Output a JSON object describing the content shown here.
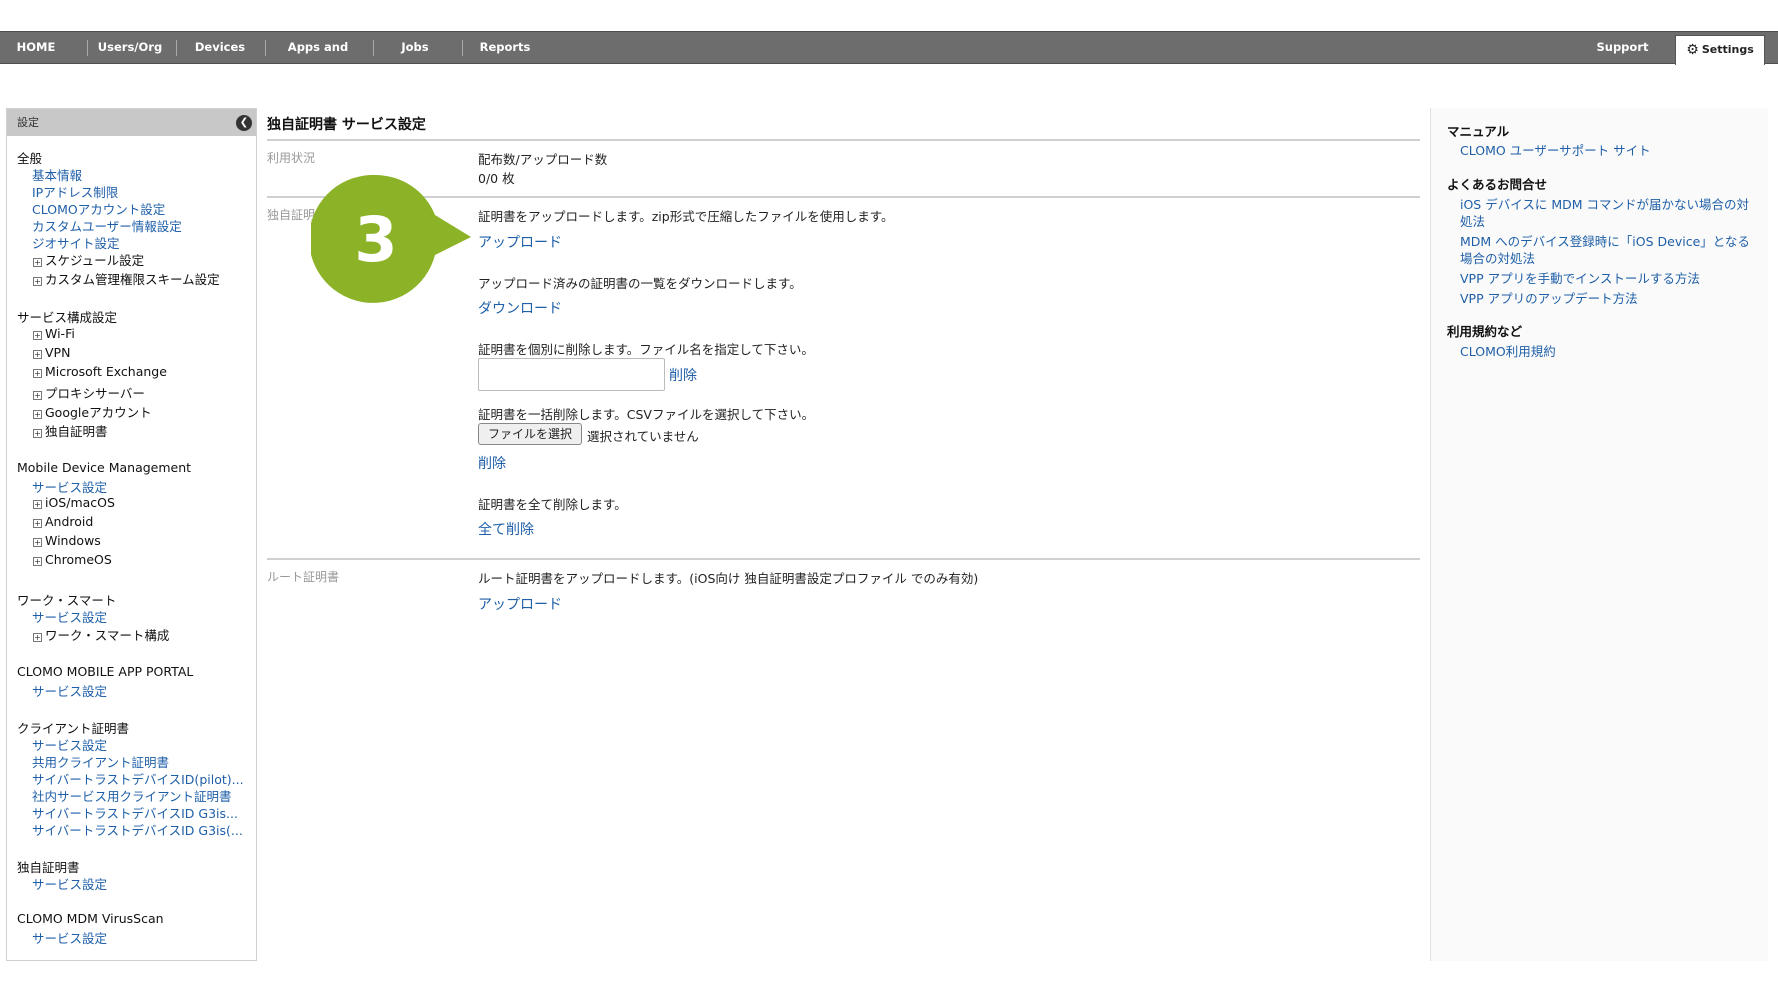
{
  "nav": {
    "items": [
      "HOME",
      "Users/Org",
      "Devices",
      "Apps and Books",
      "Jobs",
      "Reports"
    ],
    "support": "Support",
    "settings": "Settings"
  },
  "sidebar": {
    "header": "設定",
    "collapse_icon": "chevron-left-icon",
    "sections": {
      "general": {
        "title": "全般",
        "links": [
          "基本情報",
          "IPアドレス制限",
          "CLOMOアカウント設定",
          "カスタムユーザー情報設定",
          "ジオサイト設定"
        ],
        "expandables": [
          "スケジュール設定",
          "カスタム管理権限スキーム設定"
        ]
      },
      "service_config": {
        "title": "サービス構成設定",
        "expandables": [
          "Wi-Fi",
          "VPN",
          "Microsoft Exchange",
          "プロキシサーバー",
          "Googleアカウント",
          "独自証明書"
        ]
      },
      "mdm": {
        "title": "Mobile Device Management",
        "links": [
          "サービス設定"
        ],
        "expandables": [
          "iOS/macOS",
          "Android",
          "Windows",
          "ChromeOS"
        ]
      },
      "work_smart": {
        "title": "ワーク・スマート",
        "links": [
          "サービス設定"
        ],
        "expandables": [
          "ワーク・スマート構成"
        ]
      },
      "app_portal": {
        "title": "CLOMO MOBILE APP PORTAL",
        "links": [
          "サービス設定"
        ]
      },
      "client_cert": {
        "title": "クライアント証明書",
        "links": [
          "サービス設定",
          "共用クライアント証明書",
          "サイバートラストデバイスID(pilot)...",
          "社内サービス用クライアント証明書",
          "サイバートラストデバイスID G3is...",
          "サイバートラストデバイスID G3is(..."
        ]
      },
      "own_cert": {
        "title": "独自証明書",
        "links": [
          "サービス設定"
        ]
      },
      "virusscan": {
        "title": "CLOMO MDM VirusScan",
        "links": [
          "サービス設定"
        ]
      }
    }
  },
  "main": {
    "title": "独自証明書 サービス設定",
    "usage": {
      "label": "利用状況",
      "heading": "配布数/アップロード数",
      "value": "0/0 枚"
    },
    "own_cert": {
      "label": "独自証明",
      "upload_desc": "証明書をアップロードします。zip形式で圧縮したファイルを使用します。",
      "upload_link": "アップロード",
      "download_desc": "アップロード済みの証明書の一覧をダウンロードします。",
      "download_link": "ダウンロード",
      "delete_single_desc": "証明書を個別に削除します。ファイル名を指定して下さい。",
      "delete_single_link": "削除",
      "filename_value": "",
      "delete_bulk_desc": "証明書を一括削除します。CSVファイルを選択して下さい。",
      "file_button": "ファイルを選択",
      "file_status": "選択されていません",
      "delete_bulk_link": "削除",
      "delete_all_desc": "証明書を全て削除します。",
      "delete_all_link": "全て削除"
    },
    "root_cert": {
      "label": "ルート証明書",
      "desc": "ルート証明書をアップロードします。(iOS向け 独自証明書設定プロファイル でのみ有効)",
      "upload_link": "アップロード"
    }
  },
  "right": {
    "manual_title": "マニュアル",
    "manual_links": [
      "CLOMO ユーザーサポート サイト"
    ],
    "faq_title": "よくあるお問合せ",
    "faq_links": [
      "iOS デバイスに MDM コマンドが届かない場合の対処法",
      "MDM へのデバイス登録時に「iOS Device」となる場合の対処法",
      "VPP アプリを手動でインストールする方法",
      "VPP アプリのアップデート方法"
    ],
    "terms_title": "利用規約など",
    "terms_links": [
      "CLOMO利用規約"
    ]
  },
  "step_badge": {
    "number": "3",
    "color": "#8cb327"
  }
}
